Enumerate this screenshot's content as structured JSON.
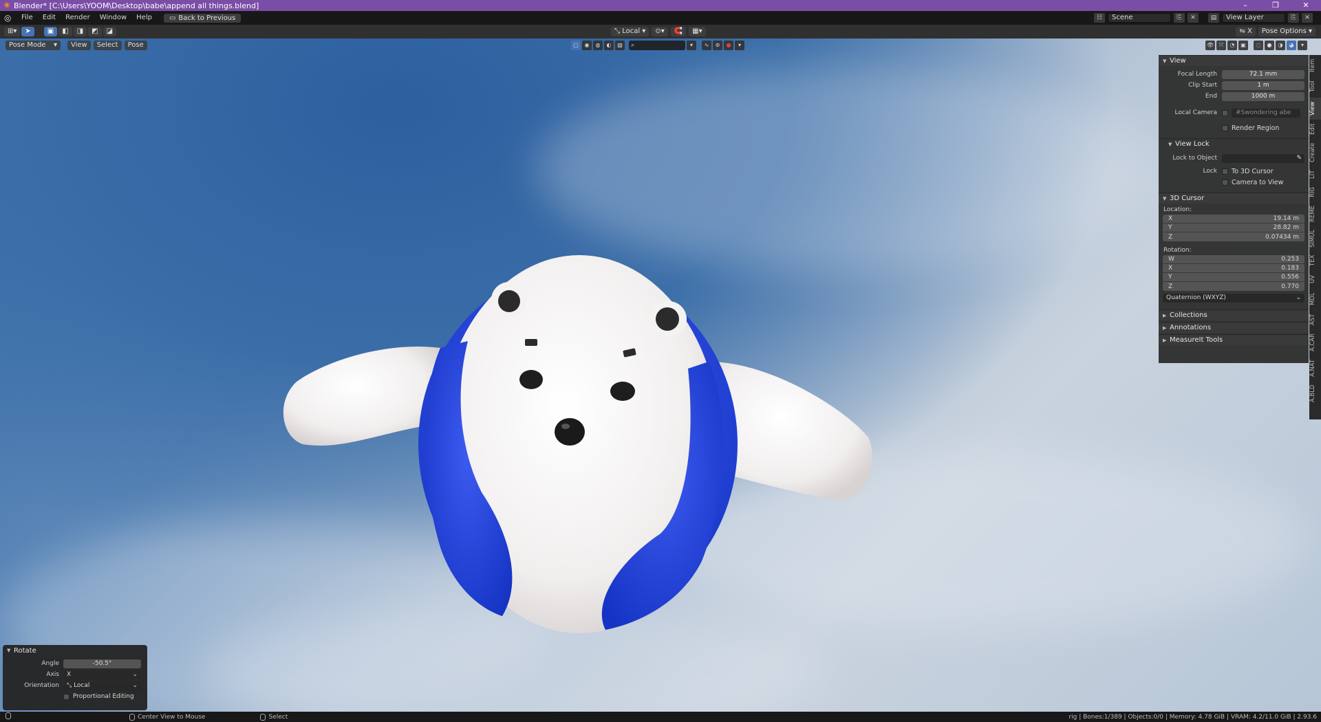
{
  "window": {
    "title": "Blender* [C:\\Users\\YOOM\\Desktop\\babe\\append all things.blend]",
    "controls": [
      "–",
      "❐",
      "✕"
    ]
  },
  "menubar": {
    "items": [
      "File",
      "Edit",
      "Render",
      "Window",
      "Help"
    ],
    "back_label": "Back to Previous",
    "scene": "Scene",
    "view_layer": "View Layer"
  },
  "toolheader": {
    "orientation": "Local",
    "pose_options": "Pose Options"
  },
  "viewport_header": {
    "mode": "Pose Mode",
    "menus": [
      "View",
      "Select",
      "Pose"
    ]
  },
  "npanel": {
    "view_section": "View",
    "focal_length_label": "Focal Length",
    "focal_length": "72.1 mm",
    "clip_start_label": "Clip Start",
    "clip_start": "1 m",
    "end_label": "End",
    "clip_end": "1000 m",
    "local_camera_label": "Local Camera",
    "local_camera_value": "#Swondering abe",
    "render_region": "Render Region",
    "view_lock_section": "View Lock",
    "lock_to_object_label": "Lock to Object",
    "lock_label": "Lock",
    "to_3d_cursor": "To 3D Cursor",
    "camera_to_view": "Camera to View",
    "cursor_section": "3D Cursor",
    "location_label": "Location:",
    "location": [
      {
        "axis": "X",
        "value": "19.14 m"
      },
      {
        "axis": "Y",
        "value": "28.82 m"
      },
      {
        "axis": "Z",
        "value": "0.07434 m"
      }
    ],
    "rotation_label": "Rotation:",
    "rotation": [
      {
        "axis": "W",
        "value": "0.253"
      },
      {
        "axis": "X",
        "value": "0.183"
      },
      {
        "axis": "Y",
        "value": "0.556"
      },
      {
        "axis": "Z",
        "value": "0.770"
      }
    ],
    "rotation_mode": "Quaternion (WXYZ)",
    "collapsed": [
      "Collections",
      "Annotations",
      "MeasureIt Tools"
    ]
  },
  "vtabs": [
    "Item",
    "Tool",
    "View",
    "Edit",
    "Create",
    "LIT",
    "RIG",
    "REME",
    "SIMUL",
    "TEX",
    "UV",
    "MDL",
    "AST",
    "A.CAR",
    "A.NAT",
    "A.BLD"
  ],
  "operator": {
    "title": "Rotate",
    "angle_label": "Angle",
    "angle": "-50.5°",
    "axis_label": "Axis",
    "axis": "X",
    "orientation_label": "Orientation",
    "orientation": "Local",
    "proportional": "Proportional Editing"
  },
  "statusbar": {
    "hint1": "Center View to Mouse",
    "hint2": "Select",
    "stats": "rig | Bones:1/389 | Objects:0/0 | Memory: 4.78 GiB | VRAM: 4.2/11.0 GiB | 2.93.6"
  },
  "colors": {
    "title_bar": "#7a4ea6",
    "accent": "#4772b3",
    "vest": "#2346d6"
  }
}
